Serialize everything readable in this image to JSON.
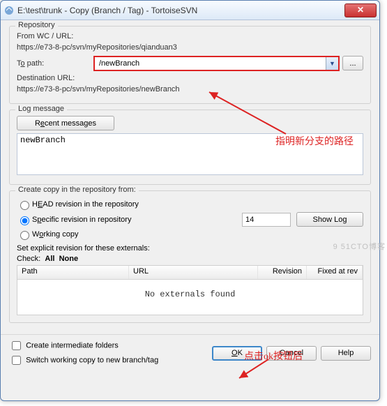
{
  "window": {
    "title": "E:\\test\\trunk - Copy (Branch / Tag) - TortoiseSVN"
  },
  "repository": {
    "group_label": "Repository",
    "from_label": "From WC / URL:",
    "from_url": "https://e73-8-pc/svn/myRepositories/qianduan3",
    "to_label_pre": "T",
    "to_label_u": "o",
    "to_label_post": " path:",
    "to_value": "/newBranch",
    "browse": "...",
    "dest_label": "Destination URL:",
    "dest_url": "https://e73-8-pc/svn/myRepositories/newBranch"
  },
  "log": {
    "group_label": "Log message",
    "recent_pre": "R",
    "recent_u": "e",
    "recent_post": "cent messages",
    "text": "newBranch"
  },
  "createfrom": {
    "group_label": "Create copy in the repository from:",
    "opt_head_pre": "H",
    "opt_head_u": "E",
    "opt_head_post": "AD revision in the repository",
    "opt_spec_pre": "S",
    "opt_spec_u": "p",
    "opt_spec_post": "ecific revision in repository",
    "spec_value": "14",
    "showlog": "Show Log",
    "opt_wc_pre": "W",
    "opt_wc_u": "o",
    "opt_wc_post": "rking copy",
    "externals_label": "Set explicit revision for these externals:",
    "check_label": "Check:",
    "check_all": "All",
    "check_none": "None",
    "th_path": "Path",
    "th_url": "URL",
    "th_rev": "Revision",
    "th_fix": "Fixed at rev",
    "no_externals": "No externals found"
  },
  "bottom": {
    "cb_intermediate": "Create intermediate folders",
    "cb_switch": "Switch working copy to new branch/tag",
    "ok_u": "O",
    "ok_post": "K",
    "cancel": "Cancel",
    "help": "Help"
  },
  "annotations": {
    "path_hint": "指明新分支的路径",
    "ok_hint": "点击ok按钮后",
    "watermark": "9 51CTO博客"
  }
}
